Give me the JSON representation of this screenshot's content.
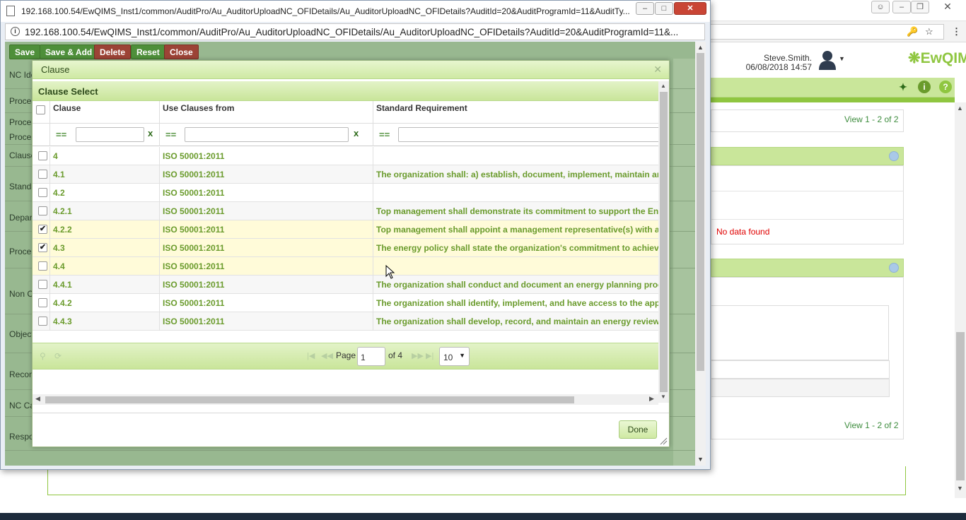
{
  "popup": {
    "title": "192.168.100.54/EwQIMS_Inst1/common/AuditPro/Au_AuditorUploadNC_OFIDetails/Au_AuditorUploadNC_OFIDetails?AuditId=20&AuditProgramId=11&AuditTy...",
    "url": "192.168.100.54/EwQIMS_Inst1/common/AuditPro/Au_AuditorUploadNC_OFIDetails/Au_AuditorUploadNC_OFIDetails?AuditId=20&AuditProgramId=11&...",
    "actions": [
      "Save",
      "Save & Add",
      "Delete",
      "Reset",
      "Close"
    ],
    "form_labels": [
      "NC Ide",
      "Proces",
      "Proces",
      "Proces",
      "Clause",
      "Standa",
      "Depar",
      "Proce",
      "Non C",
      "Object",
      "Recon",
      "NC Ca",
      "Respo"
    ]
  },
  "background": {
    "user_name": "Steve.Smith.",
    "user_datetime": "06/08/2018 14:57",
    "logo": "EwQIMS",
    "view_text_top": "View 1 - 2 of 2",
    "view_text_bottom": "View 1 - 2 of 2",
    "no_data": "No data found"
  },
  "modal": {
    "title": "Clause",
    "grid_caption": "Clause Select",
    "columns": [
      "Clause",
      "Use Clauses from",
      "Standard Requirement"
    ],
    "filter_op": "==",
    "filter_clear": "x",
    "rows": [
      {
        "clause": "4",
        "source": "ISO 50001:2011",
        "requirement": "",
        "checked": false
      },
      {
        "clause": "4.1",
        "source": "ISO 50001:2011",
        "requirement": "The organization shall: a) establish, document, implement, maintain and",
        "checked": false
      },
      {
        "clause": "4.2",
        "source": "ISO 50001:2011",
        "requirement": "",
        "checked": false
      },
      {
        "clause": "4.2.1",
        "source": "ISO 50001:2011",
        "requirement": "Top management shall demonstrate its commitment to support the EnMS",
        "checked": false
      },
      {
        "clause": "4.2.2",
        "source": "ISO 50001:2011",
        "requirement": "Top management shall appoint a management representative(s) with ap",
        "checked": true
      },
      {
        "clause": "4.3",
        "source": "ISO 50001:2011",
        "requirement": "The energy policy shall state the organization's commitment to achieving",
        "checked": true
      },
      {
        "clause": "4.4",
        "source": "ISO 50001:2011",
        "requirement": "",
        "checked": false
      },
      {
        "clause": "4.4.1",
        "source": "ISO 50001:2011",
        "requirement": "The organization shall conduct and document an energy planning process",
        "checked": false
      },
      {
        "clause": "4.4.2",
        "source": "ISO 50001:2011",
        "requirement": "The organization shall identify, implement, and have access to the applic",
        "checked": false
      },
      {
        "clause": "4.4.3",
        "source": "ISO 50001:2011",
        "requirement": "The organization shall develop, record, and maintain an energy review. T",
        "checked": false
      }
    ],
    "pager": {
      "page_label": "Page",
      "page_value": "1",
      "of_label": "of 4",
      "page_size": "10"
    },
    "done_label": "Done"
  }
}
